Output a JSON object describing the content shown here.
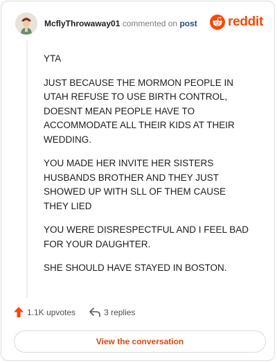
{
  "header": {
    "username": "McflyThrowaway01",
    "commented_on": "commented on",
    "post_link": "post",
    "brand": "reddit"
  },
  "comment": {
    "paragraphs": [
      "YTA",
      "JUST BECAUSE THE MORMON PEOPLE IN UTAH REFUSE TO USE BIRTH CONTROL, DOESNT MEAN PEOPLE HAVE TO ACCOMMODATE ALL THEIR KIDS AT THEIR WEDDING.",
      "YOU MADE HER INVITE HER SISTERS HUSBANDS BROTHER AND THEY JUST SHOWED UP WITH SLL OF THEM CAUSE THEY LIED",
      "YOU WERE DISRESPECTFUL AND I FEEL BAD FOR YOUR DAUGHTER.",
      "SHE SHOULD HAVE STAYED IN BOSTON."
    ]
  },
  "footer": {
    "upvotes_label": "1.1K upvotes",
    "replies_label": "3 replies",
    "cta_label": "View the conversation"
  },
  "colors": {
    "brand": "#ff4500",
    "upvote": "#ff4500",
    "link": "#1c4a86",
    "cta_text": "#d9480f"
  },
  "icons": {
    "avatar": "user-avatar",
    "logo": "reddit-snoo-icon",
    "upvote": "upvote-arrow-icon",
    "reply": "reply-arrow-icon"
  }
}
